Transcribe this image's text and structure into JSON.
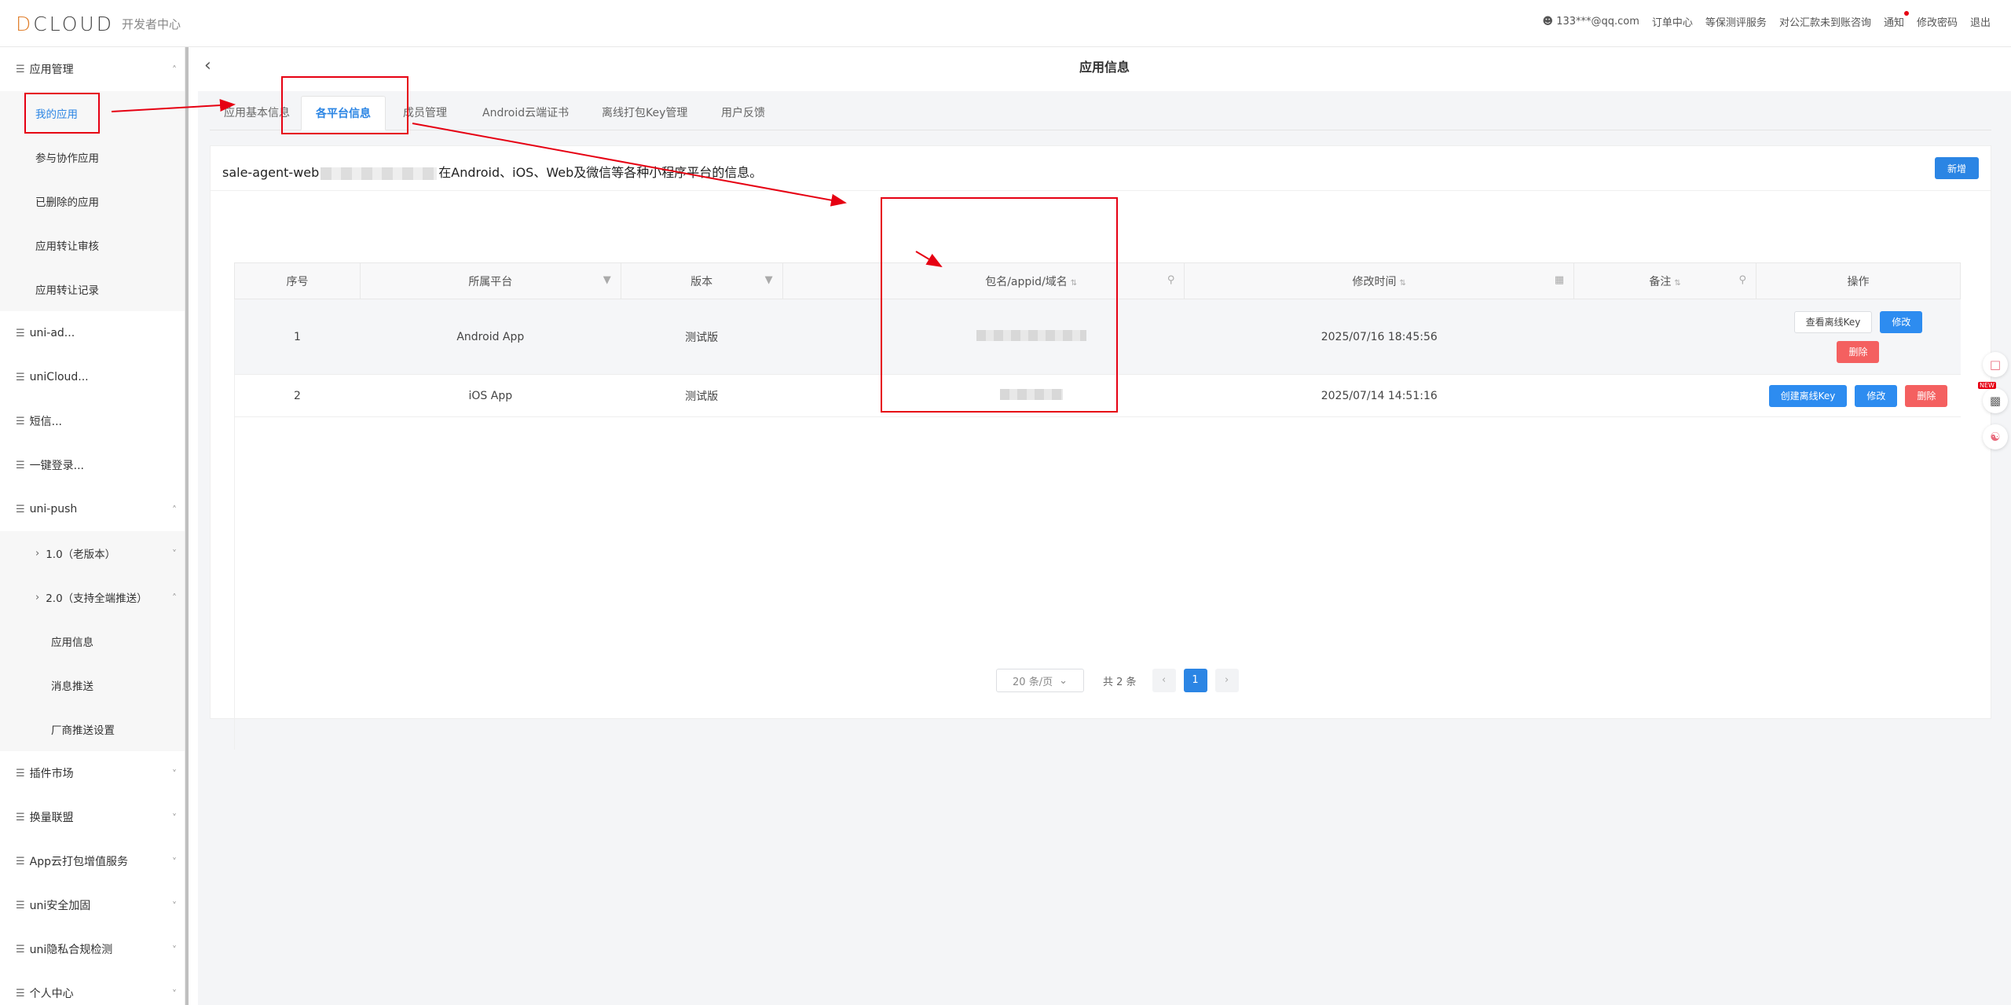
{
  "header": {
    "logo_text": "DCLOUD",
    "logo_sub": "开发者中心",
    "nav": [
      {
        "label": "133***@qq.com"
      },
      {
        "label": "订单中心"
      },
      {
        "label": "等保测评服务"
      },
      {
        "label": "对公汇款未到账咨询"
      },
      {
        "label": "通知"
      },
      {
        "label": "修改密码"
      },
      {
        "label": "退出"
      }
    ]
  },
  "sidebar": {
    "items": [
      {
        "label": "应用管理",
        "level": 0,
        "expanded": true
      },
      {
        "label": "我的应用",
        "level": 1,
        "active": true
      },
      {
        "label": "参与协作应用",
        "level": 1
      },
      {
        "label": "已删除的应用",
        "level": 1
      },
      {
        "label": "应用转让审核",
        "level": 1
      },
      {
        "label": "应用转让记录",
        "level": 1
      },
      {
        "label": "uni-ad...",
        "level": 0
      },
      {
        "label": "uniCloud...",
        "level": 0
      },
      {
        "label": "短信...",
        "level": 0
      },
      {
        "label": "一键登录...",
        "level": 0
      },
      {
        "label": "uni-push",
        "level": 0,
        "expanded": true
      },
      {
        "label": "1.0（老版本）",
        "level": 1,
        "caret": true
      },
      {
        "label": "2.0（支持全端推送）",
        "level": 1,
        "caret": true,
        "expanded": true
      },
      {
        "label": "应用信息",
        "level": 2
      },
      {
        "label": "消息推送",
        "level": 2
      },
      {
        "label": "厂商推送设置",
        "level": 2
      },
      {
        "label": "插件市场",
        "level": 0
      },
      {
        "label": "换量联盟",
        "level": 0
      },
      {
        "label": "App云打包增值服务",
        "level": 0
      },
      {
        "label": "uni安全加固",
        "level": 0
      },
      {
        "label": "uni隐私合规检测",
        "level": 0
      },
      {
        "label": "个人中心",
        "level": 0
      }
    ]
  },
  "page": {
    "title": "应用信息",
    "tabs": [
      "应用基本信息",
      "各平台信息",
      "成员管理",
      "Android云端证书",
      "离线打包Key管理",
      "用户反馈"
    ],
    "active_tab": "各平台信息",
    "desc_prefix": "sale-agent-web",
    "desc_suffix": "在Android、iOS、Web及微信等各种小程序平台的信息。",
    "add_label": "新增"
  },
  "table": {
    "columns": [
      "序号",
      "所属平台",
      "版本",
      "",
      "包名/appid/域名",
      "修改时间",
      "备注",
      "操作"
    ],
    "rows": [
      {
        "index": "1",
        "platform": "Android App",
        "version": "测试版",
        "time": "2025/07/16 18:45:56",
        "ops": [
          "查看离线Key",
          "修改",
          "删除"
        ]
      },
      {
        "index": "2",
        "platform": "iOS App",
        "version": "测试版",
        "time": "2025/07/14 14:51:16",
        "ops": [
          "创建离线Key",
          "修改",
          "删除"
        ]
      }
    ]
  },
  "pager": {
    "page_size": "20 条/页",
    "total": "共 2 条",
    "current": "1"
  },
  "float": {
    "new_tag": "NEW"
  },
  "colors": {
    "accent": "#2b85e4",
    "danger": "#f46060",
    "annotation": "#e60012"
  }
}
